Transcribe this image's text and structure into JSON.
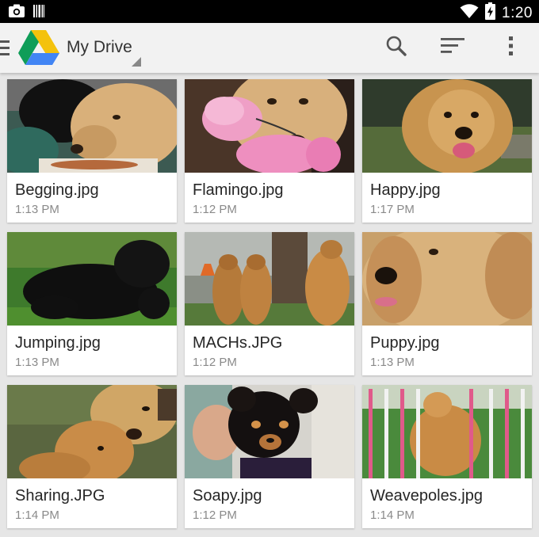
{
  "status_bar": {
    "time": "1:20",
    "icons": [
      "camera-icon",
      "barcode-icon",
      "wifi-icon",
      "battery-charging-icon"
    ]
  },
  "action_bar": {
    "title": "My Drive",
    "icons": [
      "up-navigation-icon",
      "drive-logo",
      "search-icon",
      "sort-icon",
      "overflow-menu-icon"
    ]
  },
  "files": [
    {
      "name": "Begging.jpg",
      "time": "1:13 PM"
    },
    {
      "name": "Flamingo.jpg",
      "time": "1:12 PM"
    },
    {
      "name": "Happy.jpg",
      "time": "1:17 PM"
    },
    {
      "name": "Jumping.jpg",
      "time": "1:13 PM"
    },
    {
      "name": "MACHs.JPG",
      "time": "1:12 PM"
    },
    {
      "name": "Puppy.jpg",
      "time": "1:13 PM"
    },
    {
      "name": "Sharing.JPG",
      "time": "1:14 PM"
    },
    {
      "name": "Soapy.jpg",
      "time": "1:12 PM"
    },
    {
      "name": "Weavepoles.jpg",
      "time": "1:14 PM"
    }
  ]
}
